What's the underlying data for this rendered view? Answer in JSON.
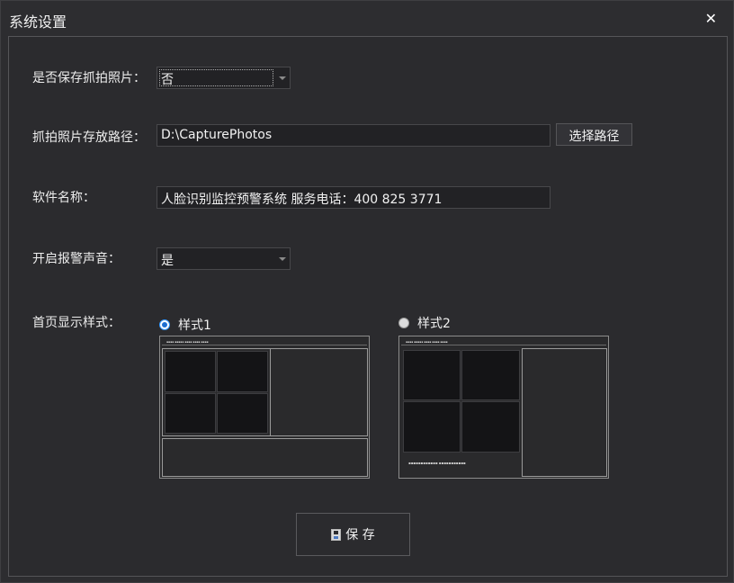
{
  "window": {
    "title": "系统设置",
    "close_glyph": "✕"
  },
  "fields": {
    "save_capture": {
      "label": "是否保存抓拍照片：",
      "value": "否"
    },
    "capture_path": {
      "label": "抓拍照片存放路径：",
      "value": "D:\\CapturePhotos",
      "button": "选择路径"
    },
    "software_name": {
      "label": "软件名称：",
      "value": "人脸识别监控预警系统 服务电话：400 825 3771"
    },
    "alarm_sound": {
      "label": "开启报警声音：",
      "value": "是"
    },
    "home_style": {
      "label": "首页显示样式：",
      "selected": "样式1",
      "options": [
        {
          "label": "样式1",
          "checked": true
        },
        {
          "label": "样式2",
          "checked": false
        }
      ]
    }
  },
  "save_button": {
    "label": "保 存",
    "icon": "floppy-disk-icon"
  },
  "colors": {
    "background": "#2d2d30",
    "border": "#555558",
    "input_bg": "#222225",
    "accent": "#1c6fd1",
    "preview_tag": "#c8d84a"
  }
}
